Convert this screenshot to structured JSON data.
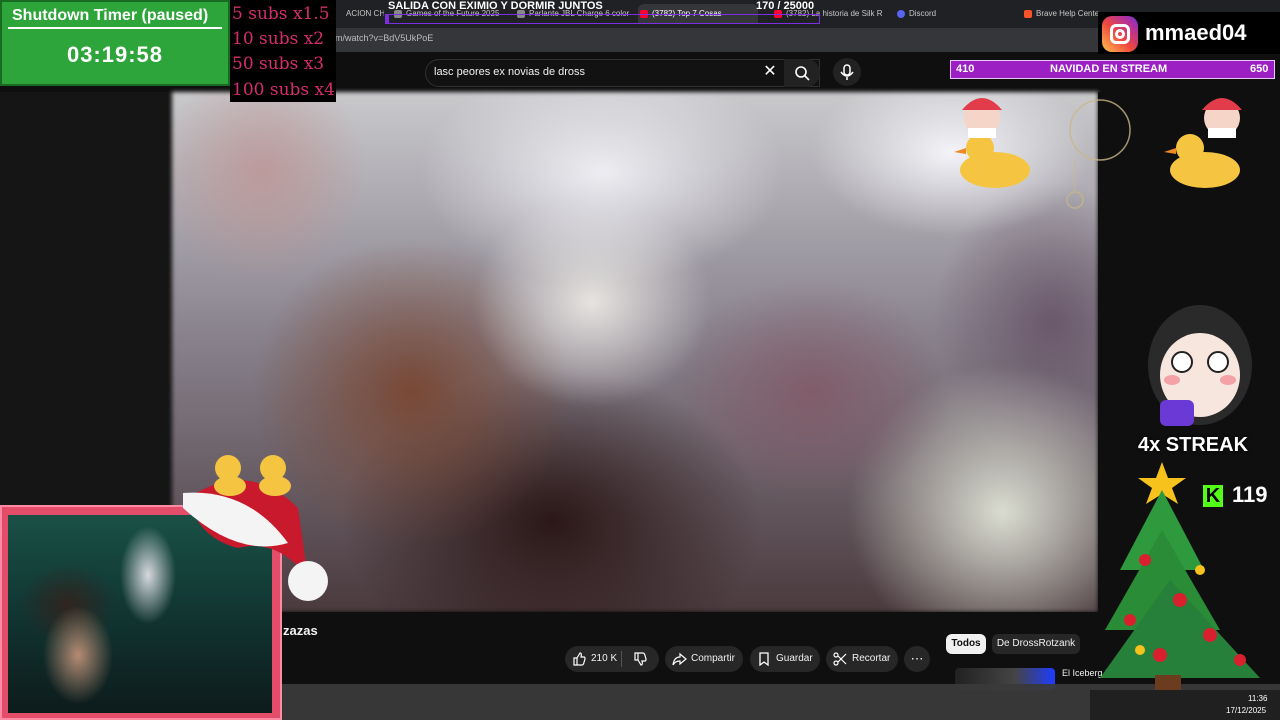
{
  "browser": {
    "tabs": [
      {
        "label": "ACION CH"
      },
      {
        "label": "Games of the Future 2025"
      },
      {
        "label": "Parlante JBL Charge 6 color"
      },
      {
        "label": "(3782) Top 7 Cosas"
      },
      {
        "label": "(3782) La historia de Silk R"
      },
      {
        "label": "Discord"
      },
      {
        "label": "Brave Help Center"
      }
    ],
    "url": "om/watch?v=BdV5UkPoE"
  },
  "youtube": {
    "search_query": "lasc peores ex novias de dross",
    "video_title_fragment": "zazas",
    "actions": {
      "like_count": "210 K",
      "share": "Compartir",
      "save": "Guardar",
      "clip": "Recortar"
    },
    "chips": [
      "Todos",
      "De DrossRotzank"
    ],
    "recommended_title": "El Iceberg De La..."
  },
  "overlay": {
    "timer_title": "Shutdown Timer (paused)",
    "timer_value": "03:19:58",
    "subs": [
      "5 subs x1.5",
      "10 subs x2",
      "50 subs x3",
      "100 subs x4"
    ],
    "goal_title": "SALIDA CON EXIMIO Y DORMIR JUNTOS",
    "goal_count": "170  / 25000",
    "goal_progress": 0.0068,
    "instagram_handle": "mmaed04",
    "navidad_left": "410",
    "navidad_center": "NAVIDAD EN STREAM",
    "navidad_right": "650",
    "streak": "4x STREAK",
    "kick_count": "119",
    "kick_letter": "K"
  },
  "taskbar": {
    "time": "11:36",
    "date": "17/12/2025"
  },
  "colors": {
    "timer_bg": "#2ea53a",
    "subs_text": "#d52d6d",
    "navidad_bg": "#9b1fc2",
    "kick_green": "#53fc18",
    "webcam_frame": "#e44d6a"
  }
}
